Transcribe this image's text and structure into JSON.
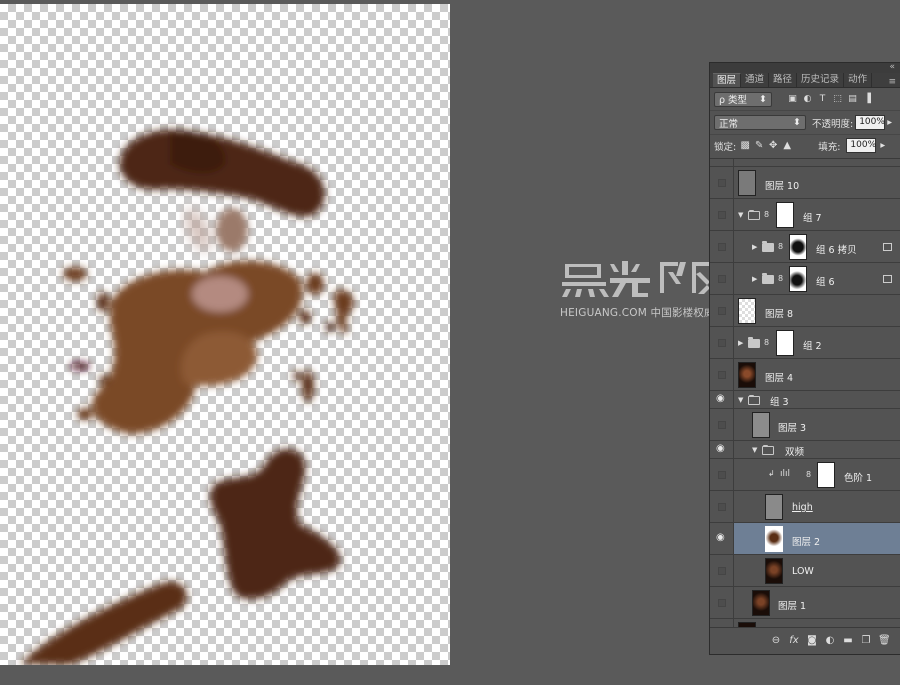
{
  "watermark": {
    "text": "HEIGUANG.COM 中国影楼权威门户"
  },
  "panel": {
    "tabs": [
      "图层",
      "通道",
      "路径",
      "历史记录",
      "动作"
    ],
    "active_tab": 0,
    "filter_label": "ρ 类型",
    "blend_mode": "正常",
    "opacity_label": "不透明度:",
    "opacity_value": "100%",
    "lock_label": "锁定:",
    "fill_label": "填充:",
    "fill_value": "100%"
  },
  "layers": [
    {
      "name": "图层 10",
      "visible": false
    },
    {
      "name": "组 7",
      "visible": false,
      "type": "group"
    },
    {
      "name": "组 6 拷贝",
      "visible": false,
      "type": "group"
    },
    {
      "name": "组 6",
      "visible": false,
      "type": "group"
    },
    {
      "name": "图层 8",
      "visible": false
    },
    {
      "name": "组 2",
      "visible": false,
      "type": "group"
    },
    {
      "name": "图层 4",
      "visible": false
    },
    {
      "name": "组 3",
      "visible": true,
      "type": "group"
    },
    {
      "name": "图层 3",
      "visible": false
    },
    {
      "name": "双频",
      "visible": true,
      "type": "group"
    },
    {
      "name": "色阶 1",
      "visible": false,
      "type": "adjustment"
    },
    {
      "name": "high",
      "visible": false
    },
    {
      "name": "图层 2",
      "visible": true,
      "selected": true
    },
    {
      "name": "LOW",
      "visible": false
    },
    {
      "name": "图层 1",
      "visible": false
    }
  ],
  "icons": {
    "collapse": "double-chevron-icon",
    "panel_menu": "panel-menu-icon",
    "bottom": [
      "link-icon",
      "fx-icon",
      "mask-icon",
      "adjustment-icon",
      "folder-icon",
      "new-layer-icon",
      "trash-icon"
    ]
  },
  "colors": {
    "app_bg": "#5a5a5a",
    "panel_bg": "#535353",
    "selection": "#6e7f95",
    "paint": "#6b3a1c"
  }
}
